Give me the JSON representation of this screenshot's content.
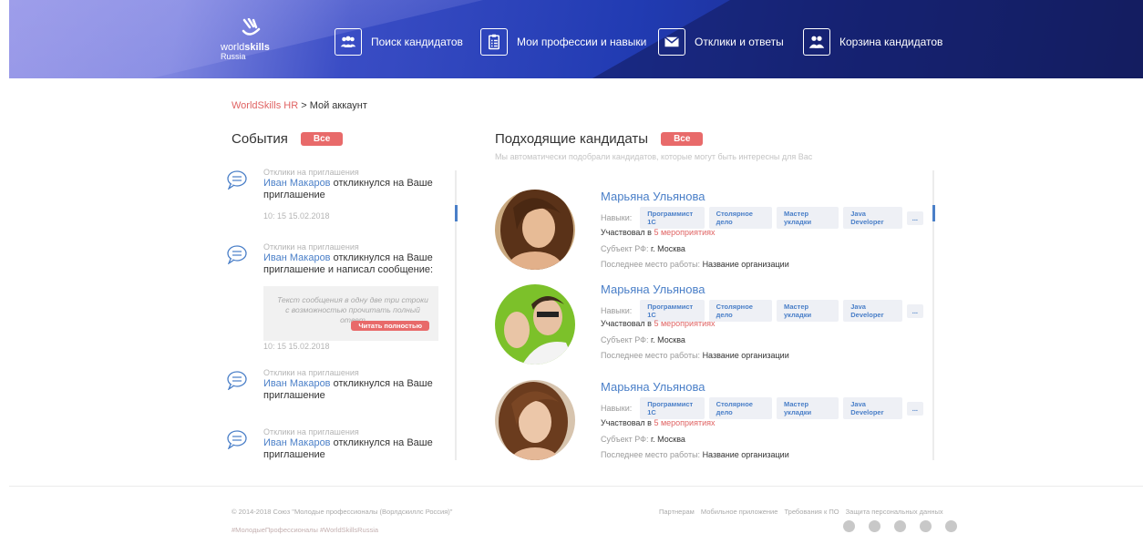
{
  "header": {
    "logo": {
      "text_world": "world",
      "text_skills": "skills",
      "text_russia": "Russia"
    },
    "nav": [
      {
        "label": "Поиск кандидатов",
        "icon": "users-icon"
      },
      {
        "label": "Мои профессии и навыки",
        "icon": "clipboard-icon"
      },
      {
        "label": "Отклики и ответы",
        "icon": "envelope-icon"
      },
      {
        "label": "Корзина кандидатов",
        "icon": "users-cart-icon"
      }
    ]
  },
  "breadcrumb": {
    "root": "WorldSkills HR",
    "separator": ">",
    "current": "Мой аккаунт"
  },
  "events": {
    "title": "События",
    "all_label": "Все",
    "items": [
      {
        "type": "Отклики на приглашения",
        "name": "Иван Макаров",
        "text": " откликнулся на Ваше приглашение",
        "time": "10: 15   15.02.2018"
      },
      {
        "type": "Отклики на приглашения",
        "name": "Иван Макаров",
        "text": " откликнулся на Ваше приглашение и написал сообщение:",
        "message": "Текст сообщения в одну две три строки с возможностью прочитать полный ответ",
        "read_more": "Читать полностью",
        "time": "10: 15   15.02.2018"
      },
      {
        "type": "Отклики на приглашения",
        "name": "Иван Макаров",
        "text": " откликнулся на Ваше приглашение"
      },
      {
        "type": "Отклики на приглашения",
        "name": "Иван Макаров",
        "text": " откликнулся на Ваше приглашение"
      }
    ]
  },
  "candidates": {
    "title": "Подходящие кандидаты",
    "all_label": "Все",
    "subtitle": "Мы автоматически подобрали кандидатов, которые могут быть интересны для Вас",
    "skills_label": "Навыки:",
    "participated_label": "Участвовал в ",
    "region_label": "Субъект РФ: ",
    "lastjob_label": "Последнее место работы: ",
    "more_label": "...",
    "items": [
      {
        "name": "Марьяна Ульянова",
        "skills": [
          "Программист 1С",
          "Столярное дело",
          "Мастер укладки",
          "Java Developer"
        ],
        "events": "5 мероприятиях",
        "region": "г. Москва",
        "lastjob": "Название организации"
      },
      {
        "name": "Марьяна Ульянова",
        "skills": [
          "Программист 1С",
          "Столярное дело",
          "Мастер укладки",
          "Java Developer"
        ],
        "events": "5 мероприятиях",
        "region": "г. Москва",
        "lastjob": "Название организации"
      },
      {
        "name": "Марьяна Ульянова",
        "skills": [
          "Программист 1С",
          "Столярное дело",
          "Мастер укладки",
          "Java Developer"
        ],
        "events": "5 мероприятиях",
        "region": "г. Москва",
        "lastjob": "Название организации"
      }
    ]
  },
  "footer": {
    "copyright": "© 2014-2018 Союз \"Молодые профессионалы (Ворлдскиллс Россия)\"",
    "hashtags": "#МолодыеПрофессионалы #WorldSkillsRussia",
    "links": [
      "Партнерам",
      "Мобильное приложение",
      "Требования к ПО",
      "Защита персональных данных"
    ],
    "socials": [
      "facebook-icon",
      "odnoklassniki-icon",
      "vk-icon",
      "twitter-icon",
      "instagram-icon"
    ]
  },
  "colors": {
    "accent": "#e86a6a",
    "link": "#4a7fc8",
    "header_dark": "#172268"
  }
}
